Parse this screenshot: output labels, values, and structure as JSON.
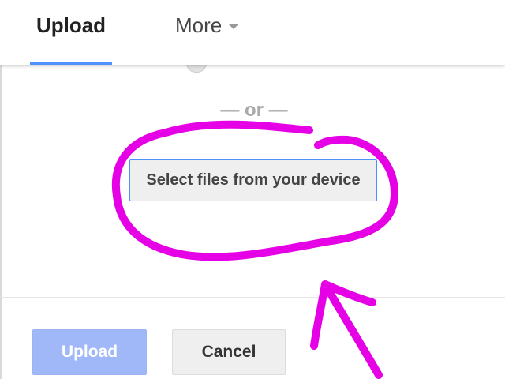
{
  "tabs": [
    {
      "label": "Upload",
      "active": true
    },
    {
      "label": "More",
      "active": false,
      "has_dropdown": true
    }
  ],
  "divider_text": "— or —",
  "select_button_label": "Select files from your device",
  "footer": {
    "upload_label": "Upload",
    "cancel_label": "Cancel"
  },
  "colors": {
    "accent": "#4d90fe",
    "upload_disabled": "#a0b8f7",
    "annotation": "#e600e6"
  },
  "icons": {
    "more_caret": "chevron-down-icon"
  }
}
